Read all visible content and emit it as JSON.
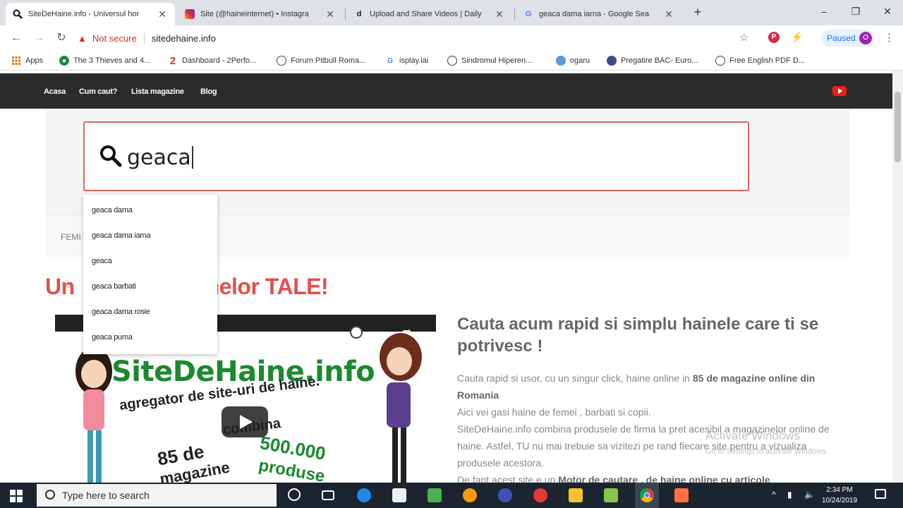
{
  "browser": {
    "tabs": [
      {
        "label": "SiteDeHaine.info - Universul hor",
        "favicon": "search-icon",
        "active": true
      },
      {
        "label": "Site (@haineinternet) • Instagra",
        "favicon": "instagram-icon",
        "active": false
      },
      {
        "label": "Upload and Share Videos | Daily",
        "favicon": "dailymotion-icon",
        "active": false
      },
      {
        "label": "geaca dama iarna - Google Sea",
        "favicon": "google-icon",
        "active": false
      }
    ],
    "security_label": "Not secure",
    "url": "sitedehaine.info",
    "profile_label": "Paused",
    "profile_initial": "O",
    "bookmarks": [
      {
        "label": "Apps",
        "icon": "apps-grid-icon"
      },
      {
        "label": "The 3 Thieves and 4...",
        "icon": "globe-icon"
      },
      {
        "label": "Dashboard - 2Perfo...",
        "icon": "bookmark-2-icon"
      },
      {
        "label": "Forum Pitbull Roma...",
        "icon": "globe-icon"
      },
      {
        "label": "isplay.iai",
        "icon": "google-icon"
      },
      {
        "label": "Sindromul Hiperen...",
        "icon": "globe-icon"
      },
      {
        "label": "ogaru",
        "icon": "globe-icon"
      },
      {
        "label": "Pregatire BAC- Euro...",
        "icon": "globe-icon"
      },
      {
        "label": "Free English PDF D...",
        "icon": "globe-icon"
      }
    ]
  },
  "site": {
    "nav": [
      "Acasa",
      "Cum caut?",
      "Lista magazine",
      "Blog"
    ],
    "search_value": "geaca",
    "category_partial": "FEMI",
    "suggestions": [
      "geaca dama",
      "geaca dama iarna",
      "geaca",
      "geaca barbati",
      "geaca dama rosie",
      "geaca puma"
    ],
    "headline_left": "Un",
    "headline_right": "nelor TALE!",
    "video": {
      "logo": "SiteDeHaine.info",
      "line1": "agregator de site-uri de haine.",
      "line2": "combina",
      "line3": "85 de",
      "line4": "magazine",
      "line5": "500.000",
      "line6": "produse"
    },
    "content_title": "Cauta acum rapid si simplu hainele care ti se potrivesc !",
    "p1_a": "Cauta rapid si usor, cu un singur click, haine online in ",
    "p1_b": "85 de magazine online din Romania",
    "p2": "Aici vei gasi haine de femei , barbati si copii.",
    "p3": "SiteDeHaine.info combina produsele de firma la pret acesibil a magazinelor online de haine. Astfel, TU nu mai trebuie sa vizitezi pe rand fiecare site pentru a vizualiza produsele acestora.",
    "p4_a": "De fapt acest site e un ",
    "p4_b": "Motor de cautare , de haine online cu articole",
    "watermark_title": "Activate Windows",
    "watermark_sub": "Go to Settings to activate Windows."
  },
  "taskbar": {
    "search_placeholder": "Type here to search",
    "time": "2:34 PM",
    "date": "10/24/2019"
  },
  "colors": {
    "accent_red": "#e0524a",
    "nav_dark": "#2b2b2b",
    "logo_green": "#1b8a2e"
  }
}
